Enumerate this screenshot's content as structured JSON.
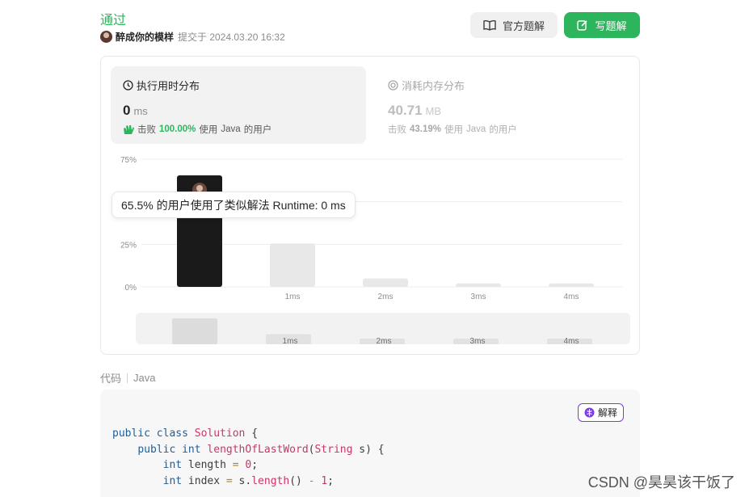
{
  "header": {
    "status": "通过",
    "user": "醉成你的模样",
    "submitted": "提交于 2024.03.20 16:32",
    "official_solution_label": "官方题解",
    "write_solution_label": "写题解"
  },
  "runtime": {
    "title": "执行用时分布",
    "value": "0",
    "unit": "ms",
    "beats_label": "击败",
    "beats_pct": "100.00%",
    "beats_suffix_pre": "使用",
    "lang": "Java",
    "beats_suffix_post": "的用户"
  },
  "memory": {
    "title": "消耗内存分布",
    "value": "40.71",
    "unit": "MB",
    "beats_label": "击败",
    "beats_pct": "43.19%",
    "beats_suffix_pre": "使用",
    "lang": "Java",
    "beats_suffix_post": "的用户"
  },
  "tooltip": "65.5% 的用户使用了类似解法 Runtime: 0 ms",
  "chart_data": {
    "type": "bar",
    "categories": [
      "",
      "1ms",
      "2ms",
      "3ms",
      "4ms"
    ],
    "values": [
      65.5,
      25.5,
      5,
      2,
      2
    ],
    "y_ticks": [
      "75%",
      "25%",
      "0%"
    ],
    "y_tick_values": [
      75,
      25,
      0
    ],
    "ylim": [
      0,
      75
    ],
    "grid": true,
    "highlight_index": 0,
    "colors": {
      "highlight": "#1a1a1a",
      "normal": "#e8e8e8",
      "grid": "#ececec"
    },
    "overview": {
      "categories": [
        "",
        "1ms",
        "2ms",
        "3ms",
        "4ms"
      ],
      "values": [
        65.5,
        25.5,
        5,
        2,
        2
      ]
    }
  },
  "code": {
    "label": "代码",
    "language": "Java",
    "explain_label": "解释"
  },
  "watermark": "CSDN @昊昊该干饭了",
  "colors": {
    "accent": "#2db55d",
    "explain_border": "#7c3aed"
  }
}
